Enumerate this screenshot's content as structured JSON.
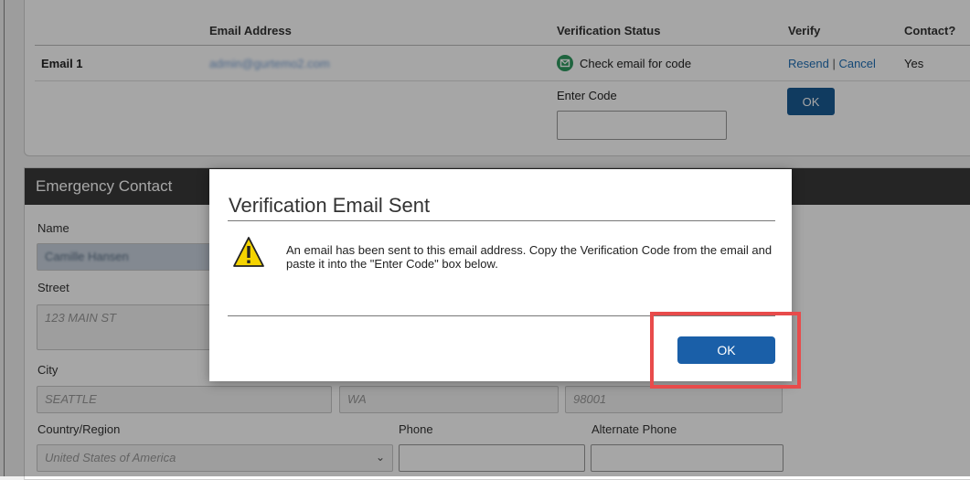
{
  "email_table": {
    "headers": {
      "email_address": "Email Address",
      "verification_status": "Verification Status",
      "verify": "Verify",
      "contact": "Contact?"
    },
    "row": {
      "label": "Email 1",
      "email": "admin@gurtemo2.com",
      "status": "Check email for code",
      "resend": "Resend",
      "separator": "|",
      "cancel": "Cancel",
      "contact": "Yes"
    },
    "enter_code_label": "Enter Code",
    "ok_label": "OK"
  },
  "emergency_contact": {
    "title": "Emergency Contact",
    "name_label": "Name",
    "name_value": "Camille Hansen",
    "street_label": "Street",
    "street_value": "123 MAIN ST",
    "city_label": "City",
    "city_value": "SEATTLE",
    "state_value": "WA",
    "zip_value": "98001",
    "country_label": "Country/Region",
    "country_value": "United States of America",
    "phone_label": "Phone",
    "alt_phone_label": "Alternate Phone"
  },
  "modal": {
    "title": "Verification Email Sent",
    "message": "An email has been sent to this email address. Copy the Verification Code from the email and paste it into the \"Enter Code\" box below.",
    "ok_label": "OK"
  },
  "icons": {
    "status": "envelope-check-icon",
    "modal": "warning-icon",
    "select": "chevron-down-icon"
  },
  "colors": {
    "primary_button": "#1a5fa8",
    "status_green": "#2e9a60",
    "highlight": "#e84b4b",
    "header_dark": "#3a3a3a"
  }
}
